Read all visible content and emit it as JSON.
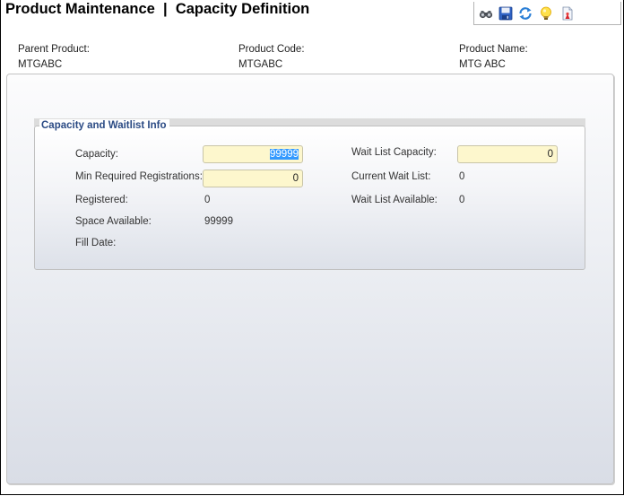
{
  "page": {
    "title": "Product Maintenance  |  Capacity Definition"
  },
  "toolbar": {
    "buttons": [
      {
        "icon": "binoculars-icon",
        "tooltip": "Find"
      },
      {
        "icon": "save-icon",
        "tooltip": "Save"
      },
      {
        "icon": "refresh-icon",
        "tooltip": "Refresh"
      },
      {
        "icon": "lightbulb-icon",
        "tooltip": "Help"
      },
      {
        "icon": "report-icon",
        "tooltip": "Report"
      }
    ]
  },
  "header": {
    "parent_product_label": "Parent Product:",
    "parent_product_value": "MTGABC",
    "product_code_label": "Product Code:",
    "product_code_value": "MTGABC",
    "product_name_label": "Product Name:",
    "product_name_value": "MTG ABC"
  },
  "capacity_section": {
    "legend": "Capacity and Waitlist Info",
    "capacity_label": "Capacity:",
    "capacity_value": "99999",
    "min_required_label": "Min Required Registrations:",
    "min_required_value": "0",
    "registered_label": "Registered:",
    "registered_value": "0",
    "space_available_label": "Space Available:",
    "space_available_value": "99999",
    "fill_date_label": "Fill Date:",
    "fill_date_value": "",
    "wait_list_capacity_label": "Wait List Capacity:",
    "wait_list_capacity_value": "0",
    "current_wait_list_label": "Current Wait List:",
    "current_wait_list_value": "0",
    "wait_list_available_label": "Wait List Available:",
    "wait_list_available_value": "0"
  },
  "colors": {
    "legend_text": "#2a4a84",
    "input_background": "#fdf7cd",
    "selection": "#3399ff"
  }
}
